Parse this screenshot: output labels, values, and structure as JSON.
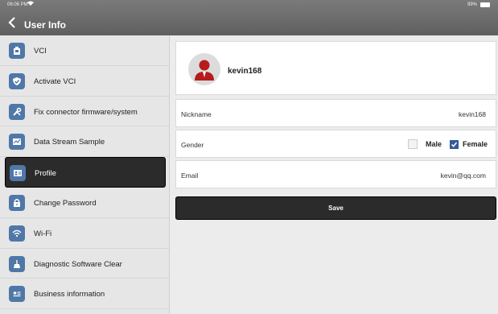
{
  "status": {
    "time": "06:06 PM",
    "battery": "99%"
  },
  "header": {
    "title": "User Info"
  },
  "sidebar": {
    "items": [
      {
        "label": "VCI",
        "icon": "vci-icon"
      },
      {
        "label": "Activate VCI",
        "icon": "shield-check-icon"
      },
      {
        "label": "Fix connector firmware/system",
        "icon": "wrench-icon"
      },
      {
        "label": "Data Stream Sample",
        "icon": "chart-icon"
      },
      {
        "label": "Profile",
        "icon": "profile-card-icon",
        "active": true
      },
      {
        "label": "Change Password",
        "icon": "lock-icon"
      },
      {
        "label": "Wi-Fi",
        "icon": "wifi-icon"
      },
      {
        "label": "Diagnostic Software Clear",
        "icon": "broom-icon"
      },
      {
        "label": "Business information",
        "icon": "business-icon"
      }
    ]
  },
  "profile": {
    "username": "kevin168"
  },
  "fields": {
    "nickname_label": "Nickname",
    "nickname_value": "kevin168",
    "gender_label": "Gender",
    "male_label": "Male",
    "female_label": "Female",
    "email_label": "Email",
    "email_value": "kevin@qq.com"
  },
  "actions": {
    "save_label": "Save"
  },
  "colors": {
    "accent": "#4f78a8",
    "header": "#6b6b6b",
    "active": "#2b2b2b"
  }
}
